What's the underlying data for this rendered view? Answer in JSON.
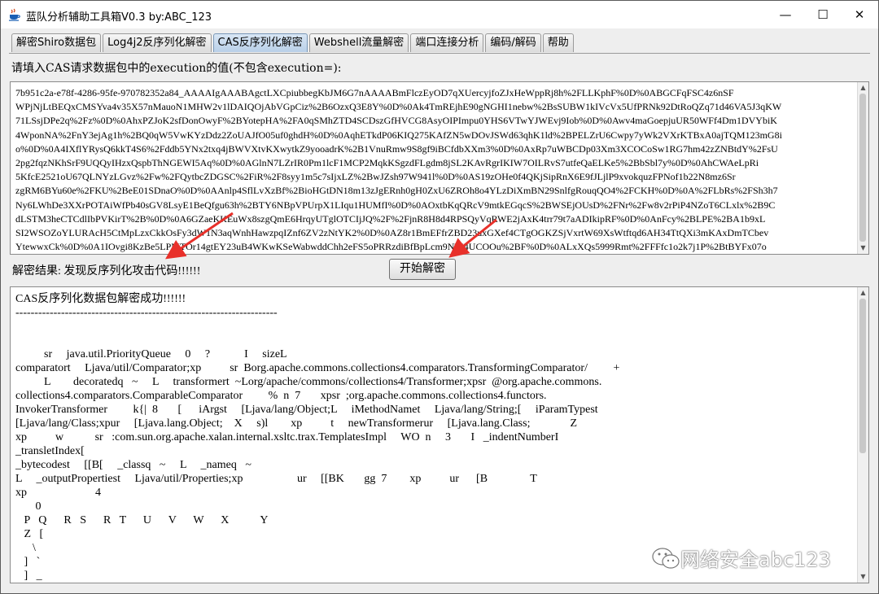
{
  "window": {
    "title": "蓝队分析辅助工具箱V0.3 by:ABC_123",
    "minimize_glyph": "—",
    "maximize_glyph": "☐",
    "close_glyph": "✕"
  },
  "tabs": [
    {
      "label": "解密Shiro数据包",
      "active": false
    },
    {
      "label": "Log4j2反序列化解密",
      "active": false
    },
    {
      "label": "CAS反序列化解密",
      "active": true
    },
    {
      "label": "Webshell流量解密",
      "active": false
    },
    {
      "label": "端口连接分析",
      "active": false
    },
    {
      "label": "编码/解码",
      "active": false
    },
    {
      "label": "帮助",
      "active": false
    }
  ],
  "input": {
    "prompt": "请填入CAS请求数据包中的execution的值(不包含execution=):",
    "lines": [
      "7b951c2a-e78f-4286-95fe-970782352a84_AAAAIgAAABAgctLXCpiubbegKbJM6G7nAAAABmFlczEyOD7qXUercyjfoZJxHeWppRj8h%2FLLKphF%0D%0ABGCFqFSC4z6nSF",
      "WPjNjLtBEQxCMSYva4v35X57nMauoN1MHW2v1lDAIQOjAbVGpCiz%2B6OzxQ3E8Y%0D%0Ak4TmREjhE90gNGHI1nebw%2BsSUBW1kIVcVx5UfPRNk92DtRoQZq71d46VA5J3qKW",
      "71LSsjDPe2q%2Fz%0D%0AhxPZJoK2sfDonOwyF%2BYotepHA%2FA0qSMhZTD4SCDszGfHVCG8AsyOIPImpu0YHS6VTwYJWEvj9Iob%0D%0Awv4maGoepjuUR50WFf4Dm1DVYbiK",
      "4WponNA%2FnY3ejAg1h%2BQ0qW5VwKYzDdz2ZoUAJfO05uf0ghdH%0D%0AqhETkdP06KIQ275KAfZN5wDOvJSWd63qhK1ld%2BPELZrU6Cwpy7yWk2VXrKTBxA0ajTQM123mG8i",
      "o%0D%0A4IXflYRysQ6kkT4S6%2Fddb5YNx2txq4jBWVXtvKXwytkZ9yooadrK%2B1VnuRmw9S8gf9iBCfdbXXm3%0D%0AxRp7uWBCDp03Xm3XCOCoSw1RG7hm42zZNBtdY%2FsU",
      "2pg2fqzNKhSrF9UQQyIHzxQspbThNGEWI5Aq%0D%0AGlnN7LZrIR0Pm1lcF1MCP2MqkKSgzdFLgdm8jSL2KAvRgrIKIW7OILRvS7utfeQaELKe5%2BbSbl7y%0D%0AhCWAeLpRi",
      "5KfcE2521oU67QLNYzLGvz%2Fw%2FQytbcZDGSC%2FiR%2F8syy1m5c7sIjxLZ%2BwJZsh97W941l%0D%0AS19zOHe0f4QKjSipRnX6E9fJLjlP9xvokquzFPNof1b22N8mz6Sr",
      "zgRM6BYu60e%2FKU%2BeE01SDnaO%0D%0AAnlp4SflLvXzBf%2BioHGtDN18m13zJgERnh0gH0ZxU6ZROh8o4YLzDiXmBN29SnlfgRouqQO4%2FCKH%0D%0A%2FLbRs%2FSh3h7",
      "Ny6LWhDe3XXrPOTAiWfPb40sGV8LsyE1BeQfgu63h%2BTY6NBpVPUrpX1LIqu1HUMfI%0D%0AOxtbKqQRcV9mtkEGqcS%2BWSEjOUsD%2FNr%2Fw8v2rPiP4NZoT6CLxlx%2B9C",
      "dLSTM3heCTCdlIbPVKirT%2B%0D%0A6GZaeKKEuWx8szgQmE6HrqyUTglOTCIjJQ%2F%2FjnR8H8d4RPSQyVqRWE2jAxK4trr79t7aADIkipRF%0D%0AnFcy%2BLPE%2BA1b9xL",
      "SI2WSOZoYLURAcH5CtMpLzxCkkOsFy3dW1N3aqWnhHawzpqIZnf6ZV2zNtYK2%0D%0AZ8r1BmEFfrZBD23uxGXef4CTgOGKZSjVxrtW69XsWtftqd6AH34TtQXi3mKAxDmTCbev",
      "YtewwxCk%0D%0A1IOvgi8KzBe5LPMTOr14gtEY23uB4WKwKSeWabwddChh2eFS5oPRRzdiBfBpLcm9NTI4UCOOu%2BF%0D%0ALxXQs5999Rmt%2FFFfc1o2k7j1P%2BtBYFx07o"
    ]
  },
  "result": {
    "text": "解密结果: 发现反序列化攻击代码!!!!!!",
    "button_label": "开始解密"
  },
  "output": {
    "lines": [
      "CAS反序列化数据包解密成功!!!!!!",
      "---------------------------------------------------------------------",
      "",
      "",
      "          sr     java.util.PriorityQueue     0     ?            I     sizeL",
      "comparatort     Ljava/util/Comparator;xp          sr  Borg.apache.commons.collections4.comparators.TransformingComparator/         +",
      "          L        decoratedq   ~     L     transformert  ~Lorg/apache/commons/collections4/Transformer;xpsr  @org.apache.commons.",
      "collections4.comparators.ComparableComparator         %  n  7       xpsr  ;org.apache.commons.collections4.functors.",
      "InvokerTransformer         k{|  8       [      iArgst     [Ljava/lang/Object;L     iMethodNamet     Ljava/lang/String;[     iParamTypest",
      "[Ljava/lang/Class;xpur     [Ljava.lang.Object;    X     s)l        xp          t     newTransformerur     [Ljava.lang.Class;              Z",
      "xp          w           sr   :com.sun.org.apache.xalan.internal.xsltc.trax.TemplatesImpl     WO  n     3       I   _indentNumberI",
      "_transletIndex[",
      "_bytecodest     [[B[     _classq   ~     L     _nameq   ~",
      "L     _outputPropertiest     Ljava/util/Properties;xp                   ur     [[BK       gg  7        xp          ur      [B               T",
      "xp                        4",
      "       0",
      "   P   Q      R   S      R   T      U      V      W      X           Y",
      "   Z   [",
      "      \\",
      "   ]   `",
      "   ]   _",
      "       a     b"
    ]
  },
  "watermark": {
    "text": "网络安全abc123"
  }
}
